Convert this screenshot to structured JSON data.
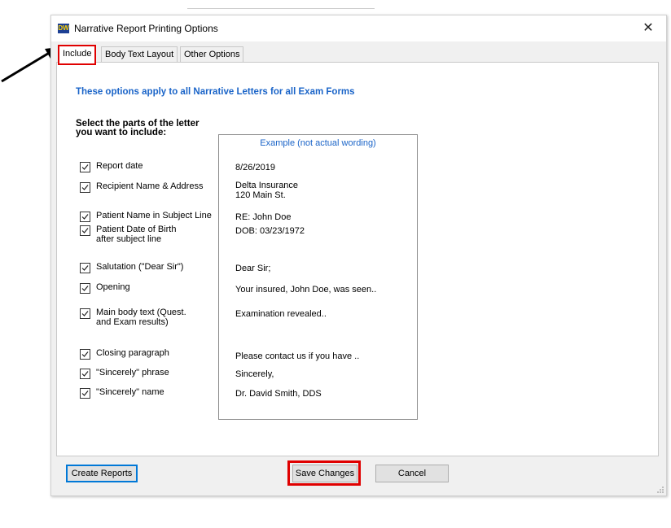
{
  "window": {
    "title": "Narrative Report Printing Options",
    "app_icon_text": "DW",
    "close_label": "✕"
  },
  "tabs": [
    {
      "label": "Include",
      "active": true
    },
    {
      "label": "Body Text Layout",
      "active": false
    },
    {
      "label": "Other Options",
      "active": false
    }
  ],
  "include_tab": {
    "heading": "These options apply to all Narrative Letters for all Exam Forms",
    "select_label_line1": "Select the parts of the letter",
    "select_label_line2": "you want to include:",
    "options": [
      {
        "label": "Report date",
        "checked": true
      },
      {
        "label": "Recipient Name & Address",
        "checked": true
      },
      {
        "label": "Patient Name in Subject Line",
        "checked": true
      },
      {
        "label_line1": "Patient Date of Birth",
        "label_line2": "after subject line",
        "checked": true
      },
      {
        "label": "Salutation (\"Dear Sir\")",
        "checked": true
      },
      {
        "label": "Opening",
        "checked": true
      },
      {
        "label_line1": "Main body text (Quest.",
        "label_line2": "and Exam results)",
        "checked": true
      },
      {
        "label": "Closing paragraph",
        "checked": true
      },
      {
        "label": "\"Sincerely\" phrase",
        "checked": true
      },
      {
        "label": "\"Sincerely\" name",
        "checked": true
      }
    ],
    "example": {
      "title": "Example (not actual wording)",
      "date": "8/26/2019",
      "recipient_line1": "Delta Insurance",
      "recipient_line2": "120 Main St.",
      "subject": "RE: John Doe",
      "dob": "DOB: 03/23/1972",
      "salutation": "Dear Sir;",
      "opening": "Your insured, John Doe, was seen..",
      "body": "Examination revealed..",
      "closing": "Please contact us if you have ..",
      "sincerely": "Sincerely,",
      "signature": "Dr. David Smith, DDS"
    }
  },
  "buttons": {
    "create_reports": "Create Reports",
    "save_changes": "Save Changes",
    "cancel": "Cancel"
  },
  "colors": {
    "accent_blue": "#1a64c8",
    "highlight_red": "#e00000"
  }
}
